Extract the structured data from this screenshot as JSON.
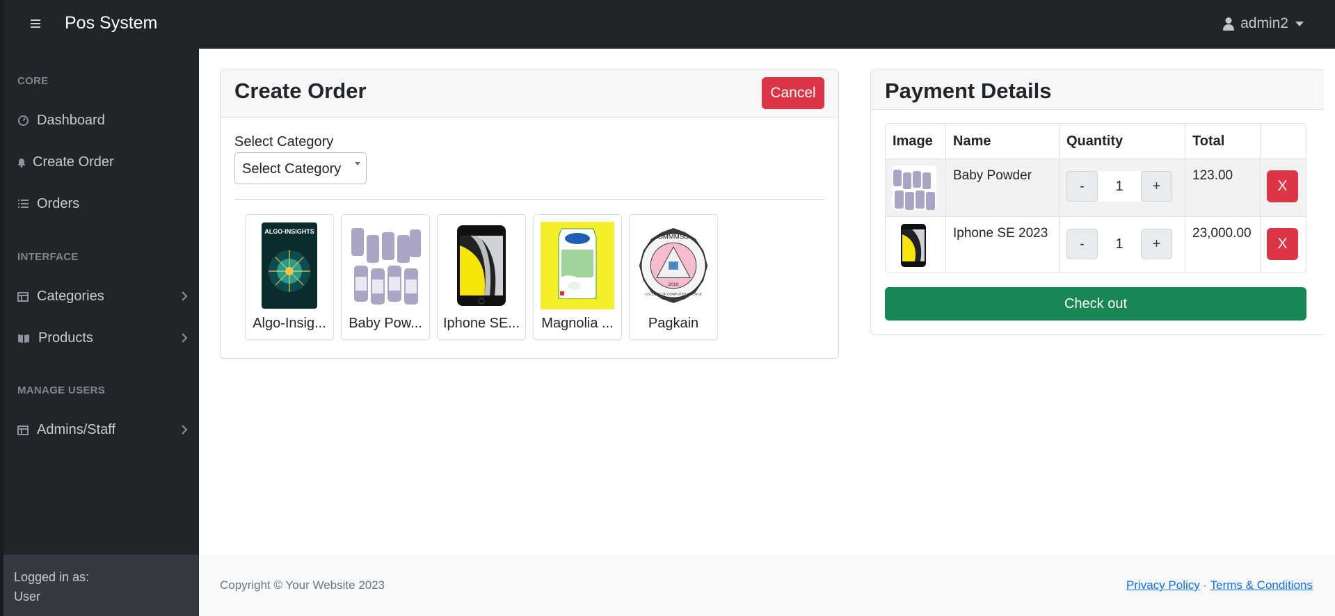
{
  "navbar": {
    "brand": "Pos System",
    "user": "admin2"
  },
  "sidebar": {
    "headings": {
      "core": "CORE",
      "interface": "INTERFACE",
      "manage_users": "MANAGE USERS"
    },
    "items": {
      "dashboard": "Dashboard",
      "create_order": "Create Order",
      "orders": "Orders",
      "categories": "Categories",
      "products": "Products",
      "admins_staff": "Admins/Staff"
    },
    "footer": {
      "label": "Logged in as:",
      "user": "User"
    }
  },
  "create_order": {
    "title": "Create Order",
    "cancel_label": "Cancel",
    "select_category_label": "Select Category",
    "select_category_value": "Select Category",
    "products": [
      {
        "name": "Algo-Insig...",
        "image_text": "ALGO-INSIGHTS"
      },
      {
        "name": "Baby Pow..."
      },
      {
        "name": "Iphone SE..."
      },
      {
        "name": "Magnolia ..."
      },
      {
        "name": "Pagkain",
        "image_text": "DMMMSU",
        "image_text2": "COLLEGE OF COMPUTER SCIENCE",
        "image_year": "2010"
      }
    ]
  },
  "payment": {
    "title": "Payment Details",
    "columns": {
      "image": "Image",
      "name": "Name",
      "quantity": "Quantity",
      "total": "Total"
    },
    "rows": [
      {
        "name": "Baby Powder",
        "qty": "1",
        "total": "123.00"
      },
      {
        "name": "Iphone SE 2023",
        "qty": "1",
        "total": "23,000.00"
      }
    ],
    "minus_label": "-",
    "plus_label": "+",
    "remove_label": "X",
    "checkout_label": "Check out"
  },
  "footer": {
    "copyright": "Copyright © Your Website 2023",
    "privacy": "Privacy Policy",
    "separator": "·",
    "terms": "Terms & Conditions"
  },
  "colors": {
    "navbar": "#212529",
    "danger": "#dc3545",
    "success": "#198754",
    "link": "#0d6efd"
  }
}
